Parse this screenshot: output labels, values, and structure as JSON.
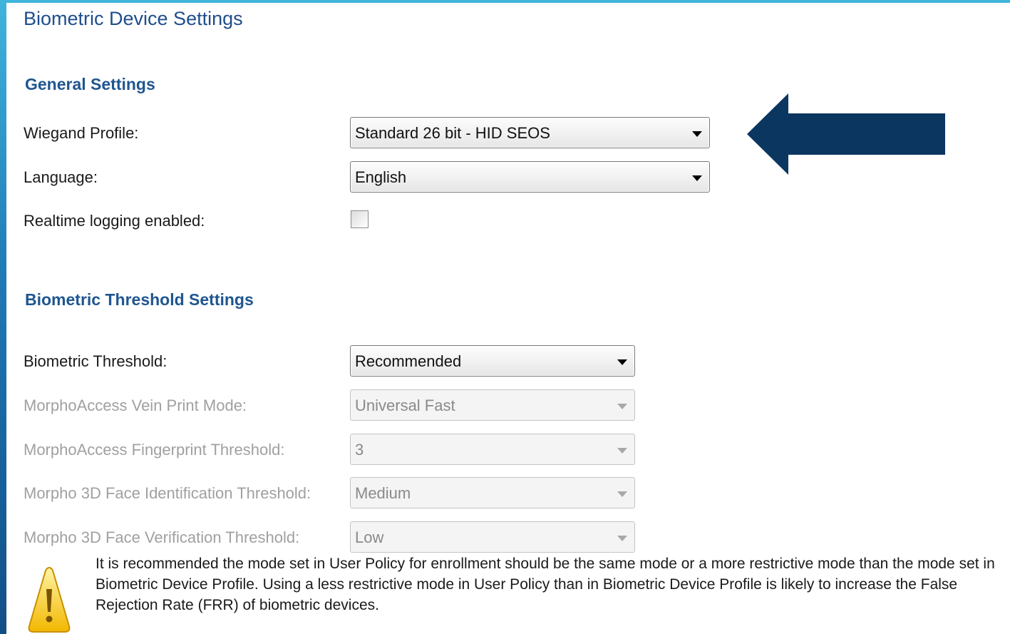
{
  "page": {
    "title": "Biometric Device Settings"
  },
  "general_settings": {
    "heading": "General Settings",
    "wiegand_profile": {
      "label": "Wiegand Profile:",
      "value": "Standard 26 bit - HID SEOS"
    },
    "language": {
      "label": "Language:",
      "value": "English"
    },
    "realtime_logging": {
      "label": "Realtime logging enabled:",
      "checked": false
    }
  },
  "biometric_threshold_settings": {
    "heading": "Biometric Threshold Settings",
    "biometric_threshold": {
      "label": "Biometric Threshold:",
      "value": "Recommended",
      "enabled": true
    },
    "vein_print_mode": {
      "label": "MorphoAccess Vein Print Mode:",
      "value": "Universal Fast",
      "enabled": false
    },
    "fingerprint_threshold": {
      "label": "MorphoAccess Fingerprint Threshold:",
      "value": "3",
      "enabled": false
    },
    "face_identification_threshold": {
      "label": "Morpho 3D Face Identification Threshold:",
      "value": "Medium",
      "enabled": false
    },
    "face_verification_threshold": {
      "label": "Morpho 3D Face Verification Threshold:",
      "value": "Low",
      "enabled": false
    }
  },
  "notice": {
    "icon": "warning-icon",
    "text": "It is recommended the mode set in User Policy for enrollment should be the same mode or a more restrictive mode than the mode set in Biometric Device Profile.  Using a less restrictive mode in User Policy than in Biometric Device Profile is likely to increase the False Rejection Rate (FRR) of biometric devices."
  },
  "annotation": {
    "icon": "left-arrow-icon",
    "color": "#0b3660"
  },
  "colors": {
    "accent": "#1f5690",
    "frame": "#3fb4dc"
  }
}
